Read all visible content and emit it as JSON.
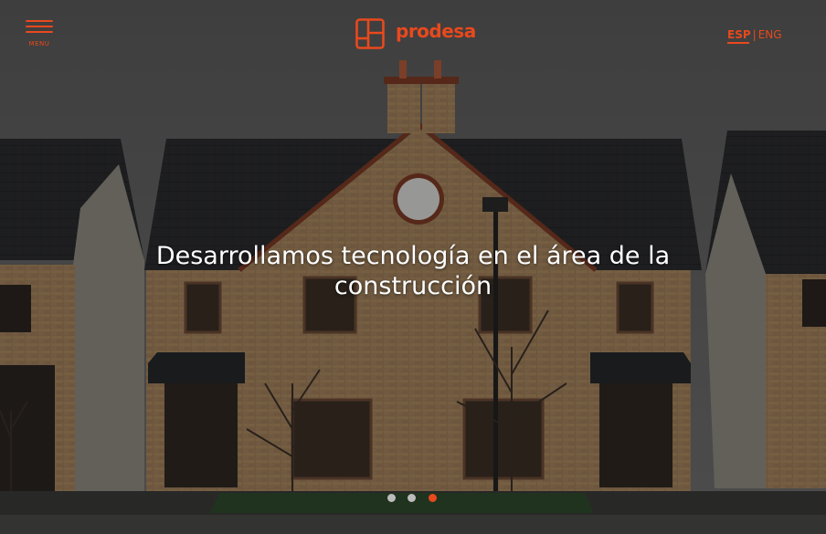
{
  "header": {
    "menu_label": "MENU",
    "logo_text": "prodesa",
    "lang_active": "ESP",
    "lang_separator": "|",
    "lang_other": "ENG"
  },
  "hero": {
    "headline": "Desarrollamos tecnología en el área de la construcción"
  },
  "slider": {
    "dots": [
      {
        "label": "slide-1",
        "active": false
      },
      {
        "label": "slide-2",
        "active": false
      },
      {
        "label": "slide-3",
        "active": true
      }
    ]
  },
  "colors": {
    "brand": "#e8491d",
    "text": "#ffffff",
    "dot_inactive": "#bcbcbc"
  }
}
